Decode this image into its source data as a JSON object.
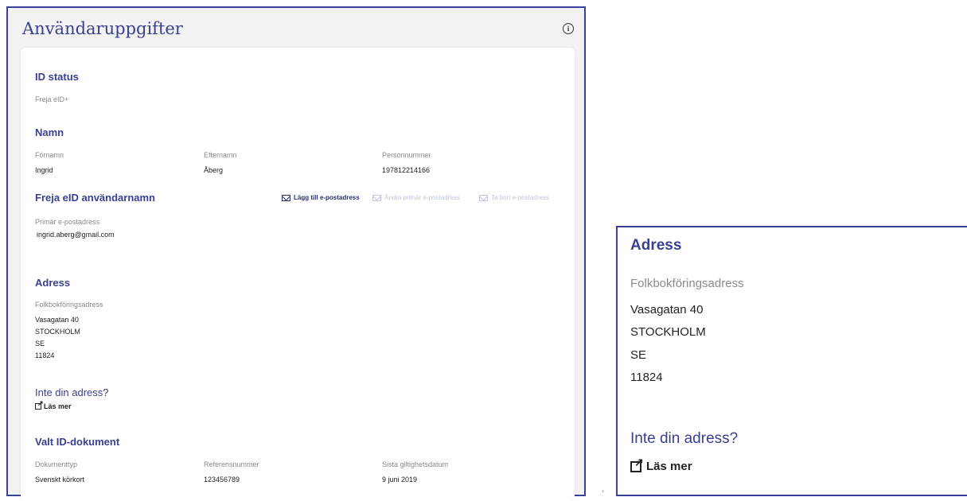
{
  "header": {
    "title": "Användaruppgifter",
    "info_icon": "info-icon"
  },
  "id_status": {
    "heading": "ID status",
    "value": "Freja eID+"
  },
  "name": {
    "heading": "Namn",
    "fields": [
      {
        "label": "Förnamn",
        "value": "Ingrid"
      },
      {
        "label": "Efternamn",
        "value": "Åberg"
      },
      {
        "label": "Personnummer",
        "value": "197812214166"
      }
    ]
  },
  "username": {
    "heading": "Freja eID användarnamn",
    "actions": [
      {
        "label": "Lägg till e-postadress",
        "icon": "mail-icon",
        "enabled": true
      },
      {
        "label": "Ändra primär e-postadress",
        "icon": "mail-icon",
        "enabled": false
      },
      {
        "label": "Ta bort e-postadress",
        "icon": "mail-icon",
        "enabled": false
      }
    ],
    "email_label": "Primär e-postadress",
    "email_value": "ingrid.aberg@gmail.com"
  },
  "address": {
    "heading": "Adress",
    "label": "Folkbokföringsadress",
    "lines": [
      "Vasagatan 40",
      "STOCKHOLM",
      "SE",
      "11824"
    ]
  },
  "not_your_address": {
    "heading": "Inte din adress?",
    "link": "Läs mer",
    "icon": "external-link-icon"
  },
  "id_document": {
    "heading": "Valt ID-dokument",
    "fields": [
      {
        "label": "Dokumenttyp",
        "value": "Svenskt körkort"
      },
      {
        "label": "Referensnummer",
        "value": "123456789"
      },
      {
        "label": "Sista giltighetsdatum",
        "value": "9 juni 2019"
      }
    ]
  },
  "colors": {
    "accent": "#3a3f8f",
    "frame": "#3b3f9c",
    "disabled": "#c2c5e0"
  }
}
